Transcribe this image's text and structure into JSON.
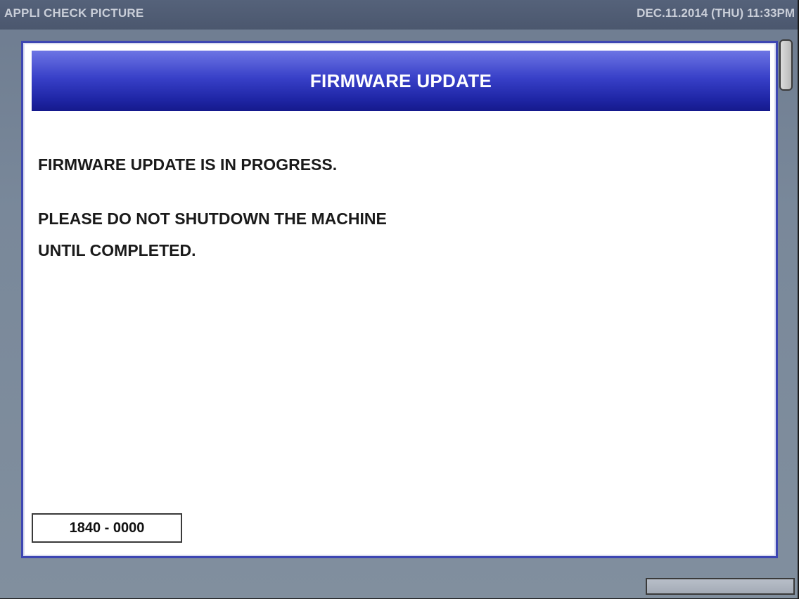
{
  "topbar": {
    "app_title": "APPLI CHECK PICTURE",
    "datetime": "DEC.11.2014 (THU)  11:33PM"
  },
  "dialog": {
    "title": "FIRMWARE UPDATE",
    "message_line1": "FIRMWARE UPDATE IS IN PROGRESS.",
    "message_line2": "PLEASE DO NOT SHUTDOWN THE MACHINE",
    "message_line3": "UNTIL COMPLETED.",
    "code": "1840 - 0000"
  },
  "colors": {
    "header_blue": "#3840c8",
    "dialog_border": "#3d46b2",
    "background": "#79889a"
  }
}
